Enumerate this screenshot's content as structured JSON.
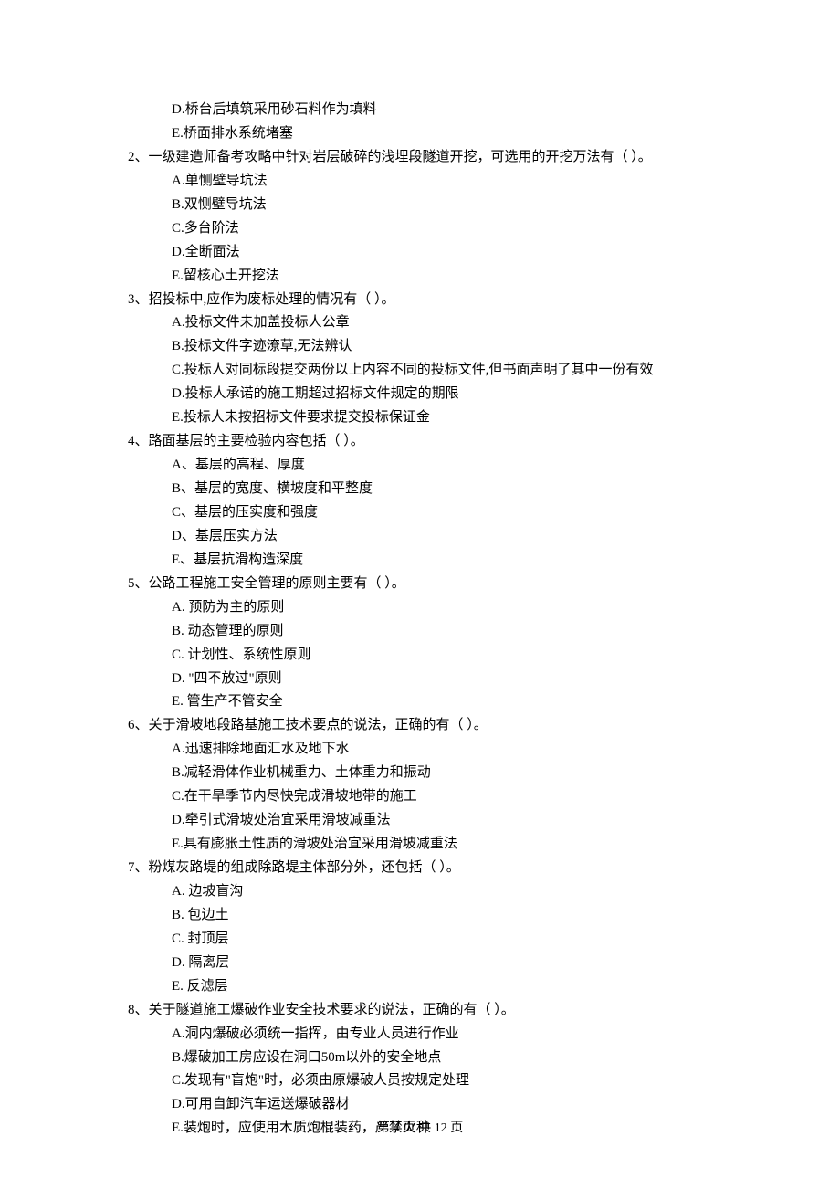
{
  "blankMarker": "（    ）。",
  "preOptions": [
    "D.桥台后填筑采用砂石料作为填料",
    "E.桥面排水系统堵塞"
  ],
  "questions": [
    {
      "number": "2、",
      "stem": "一级建造师备考攻略中针对岩层破碎的浅埋段隧道开挖，可选用的开挖万法有",
      "options": [
        "A.单恻壁导坑法",
        "B.双恻壁导坑法",
        "C.多台阶法",
        "D.全断面法",
        "E.留核心土开挖法"
      ]
    },
    {
      "number": "3、",
      "stem": "招投标中,应作为废标处理的情况有",
      "options": [
        "A.投标文件未加盖投标人公章",
        "B.投标文件字迹潦草,无法辨认",
        "C.投标人对同标段提交两份以上内容不同的投标文件,但书面声明了其中一份有效",
        "D.投标人承诺的施工期超过招标文件规定的期限",
        "E.投标人未按招标文件要求提交投标保证金"
      ]
    },
    {
      "number": "4、",
      "stem": "路面基层的主要检验内容包括",
      "options": [
        "A、基层的高程、厚度",
        "B、基层的宽度、横坡度和平整度",
        "C、基层的压实度和强度",
        "D、基层压实方法",
        "E、基层抗滑构造深度"
      ]
    },
    {
      "number": "5、",
      "stem": "公路工程施工安全管理的原则主要有",
      "options": [
        "A. 预防为主的原则",
        "B. 动态管理的原则",
        "C. 计划性、系统性原则",
        "D. \"四不放过\"原则",
        "E. 管生产不管安全"
      ]
    },
    {
      "number": "6、",
      "stem": "关于滑坡地段路基施工技术要点的说法，正确的有",
      "options": [
        "A.迅速排除地面汇水及地下水",
        "B.减轻滑体作业机械重力、土体重力和振动",
        "C.在干旱季节内尽快完成滑坡地带的施工",
        "D.牵引式滑坡处治宜采用滑坡减重法",
        "E.具有膨胀土性质的滑坡处治宜采用滑坡减重法"
      ]
    },
    {
      "number": "7、",
      "stem": "粉煤灰路堤的组成除路堤主体部分外，还包括",
      "options": [
        "A. 边坡盲沟",
        "B. 包边土",
        "C. 封顶层",
        "D. 隔离层",
        "E. 反滤层"
      ]
    },
    {
      "number": "8、",
      "stem": "关于隧道施工爆破作业安全技术要求的说法，正确的有",
      "options": [
        "A.洞内爆破必须统一指挥，由专业人员进行作业",
        "B.爆破加工房应设在洞口50m以外的安全地点",
        "C.发现有\"盲炮\"时，必须由原爆破人员按规定处理",
        "D.可用自卸汽车运送爆破器材",
        "E.装炮时，应使用木质炮棍装药，严禁火种"
      ]
    }
  ],
  "footer": "第 4 页 共 12 页"
}
